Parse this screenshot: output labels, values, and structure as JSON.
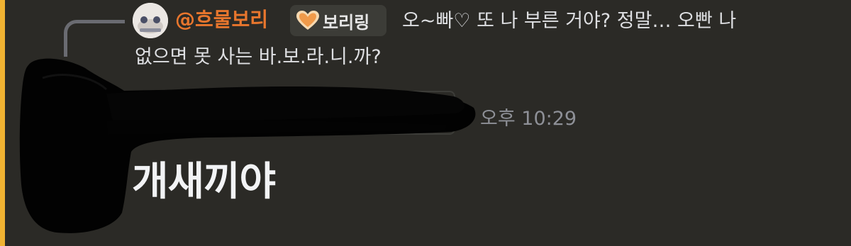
{
  "reply": {
    "username": "@흐물보리",
    "role_tag": "보리링",
    "role_icon": "orange-heart-icon",
    "text_line1": "오~빠♡ 또 나 부른 거야? 정말… 오빤 나",
    "text_line2": "없으면 못 사는 바.보.라.니.까?"
  },
  "message": {
    "timestamp": "오후 10:29",
    "text": "개새끼야"
  },
  "colors": {
    "background": "#2b2a26",
    "mention_accent": "#f0b232",
    "username": "#e8762d",
    "role_tag_bg": "#3c3c37",
    "heart": "#f0a35a"
  }
}
